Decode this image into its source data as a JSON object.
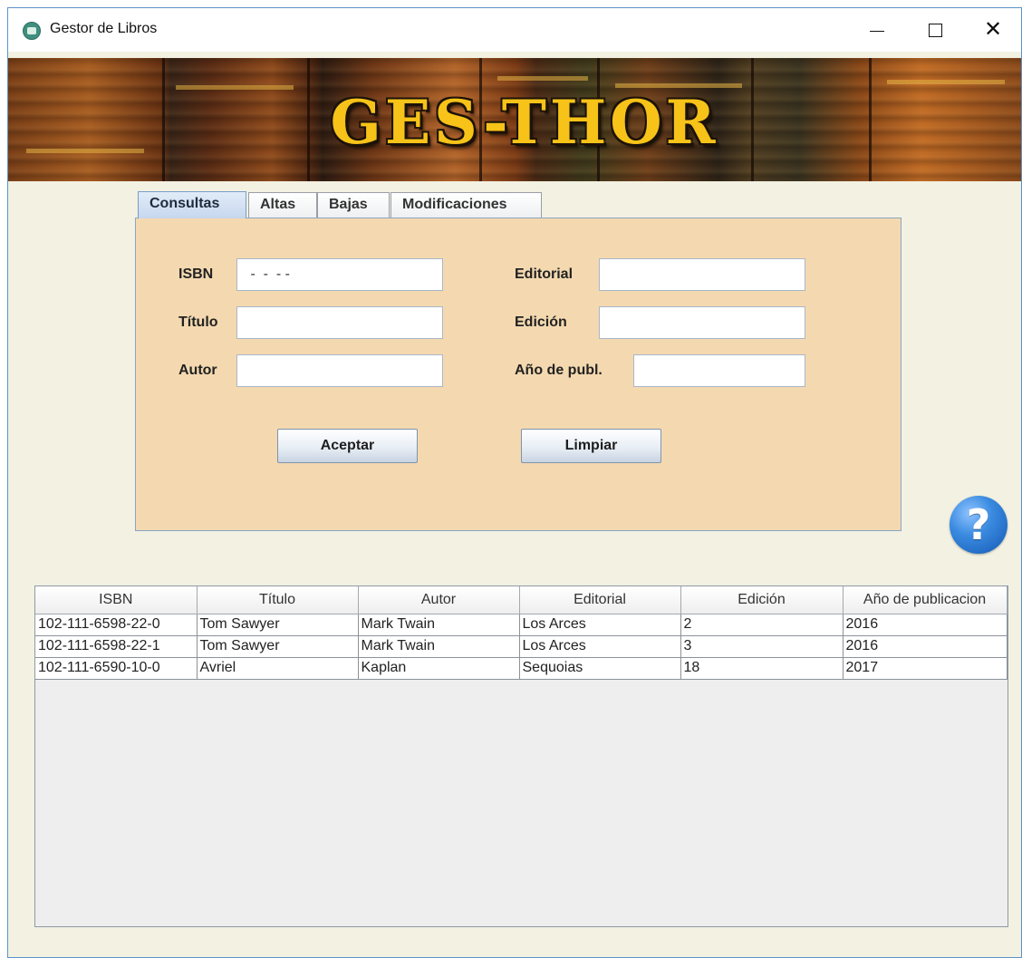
{
  "window": {
    "title": "Gestor de Libros",
    "minimize": "—",
    "maximize": "☐",
    "close": "✕"
  },
  "banner": {
    "title": "GES-THOR"
  },
  "tabs": [
    {
      "label": "Consultas",
      "active": true
    },
    {
      "label": "Altas",
      "active": false
    },
    {
      "label": "Bajas",
      "active": false
    },
    {
      "label": "Modificaciones",
      "active": false
    }
  ],
  "form": {
    "isbn": {
      "label": "ISBN",
      "value": " -  -  - -"
    },
    "titulo": {
      "label": "Título",
      "value": ""
    },
    "autor": {
      "label": "Autor",
      "value": ""
    },
    "editorial": {
      "label": "Editorial",
      "value": ""
    },
    "edicion": {
      "label": "Edición",
      "value": ""
    },
    "anio": {
      "label": "Año de publ.",
      "value": ""
    },
    "accept_label": "Aceptar",
    "clear_label": "Limpiar"
  },
  "help": {
    "icon": "question-help-icon",
    "glyph": "?"
  },
  "table": {
    "columns": [
      "ISBN",
      "Título",
      "Autor",
      "Editorial",
      "Edición",
      "Año de publicacion"
    ],
    "rows": [
      [
        "102-111-6598-22-0",
        "Tom Sawyer",
        "Mark Twain",
        "Los Arces",
        "2",
        "2016"
      ],
      [
        "102-111-6598-22-1",
        "Tom Sawyer",
        "Mark Twain",
        "Los Arces",
        "3",
        "2016"
      ],
      [
        "102-111-6590-10-0",
        "Avriel",
        "Kaplan",
        "Sequoias",
        "18",
        "2017"
      ]
    ]
  },
  "colors": {
    "panel": "#f4d9b0",
    "window_bg": "#f2f1e2",
    "banner_title": "#f7c318",
    "help_blue": "#1f6fd0"
  }
}
